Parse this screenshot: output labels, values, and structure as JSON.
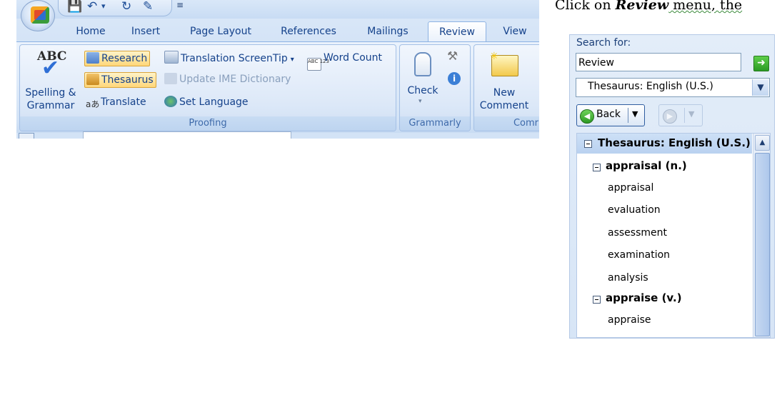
{
  "instruction": {
    "text": "Click on ",
    "emphasis": "Review",
    "trailing": " menu, the"
  },
  "quick_access": {
    "save_icon": "save-icon",
    "undo_icon": "undo-icon",
    "redo_icon": "redo-icon",
    "customize_icon": "customize-qat-icon"
  },
  "tabs": [
    "Home",
    "Insert",
    "Page Layout",
    "References",
    "Mailings",
    "Review",
    "View"
  ],
  "ribbon": {
    "proofing": {
      "group_label": "Proofing",
      "spelling_label_1": "Spelling &",
      "spelling_label_2": "Grammar",
      "abc": "ABC",
      "research": "Research",
      "thesaurus": "Thesaurus",
      "translate": "Translate",
      "translation_screentip": "Translation ScreenTip",
      "update_ime": "Update IME Dictionary",
      "set_language": "Set Language",
      "word_count": "Word Count"
    },
    "grammarly": {
      "group_label": "Grammarly",
      "check": "Check"
    },
    "comments": {
      "group_label": "Comr",
      "new_comment_1": "New",
      "new_comment_2": "Comment"
    }
  },
  "research_pane": {
    "search_for_label": "Search for:",
    "search_value": "Review",
    "source": "Thesaurus: English (U.S.)",
    "back_label": "Back",
    "results_header": "Thesaurus: English (U.S.)",
    "entries": [
      {
        "heading": "appraisal (n.)",
        "items": [
          "appraisal",
          "evaluation",
          "assessment",
          "examination",
          "analysis"
        ]
      },
      {
        "heading": "appraise (v.)",
        "items": [
          "appraise"
        ]
      }
    ]
  },
  "colors": {
    "ribbon_bg": "#dbe8f8",
    "ribbon_text": "#15428b",
    "highlight": "#ffd77a",
    "results_header": "#c6dbf5"
  }
}
